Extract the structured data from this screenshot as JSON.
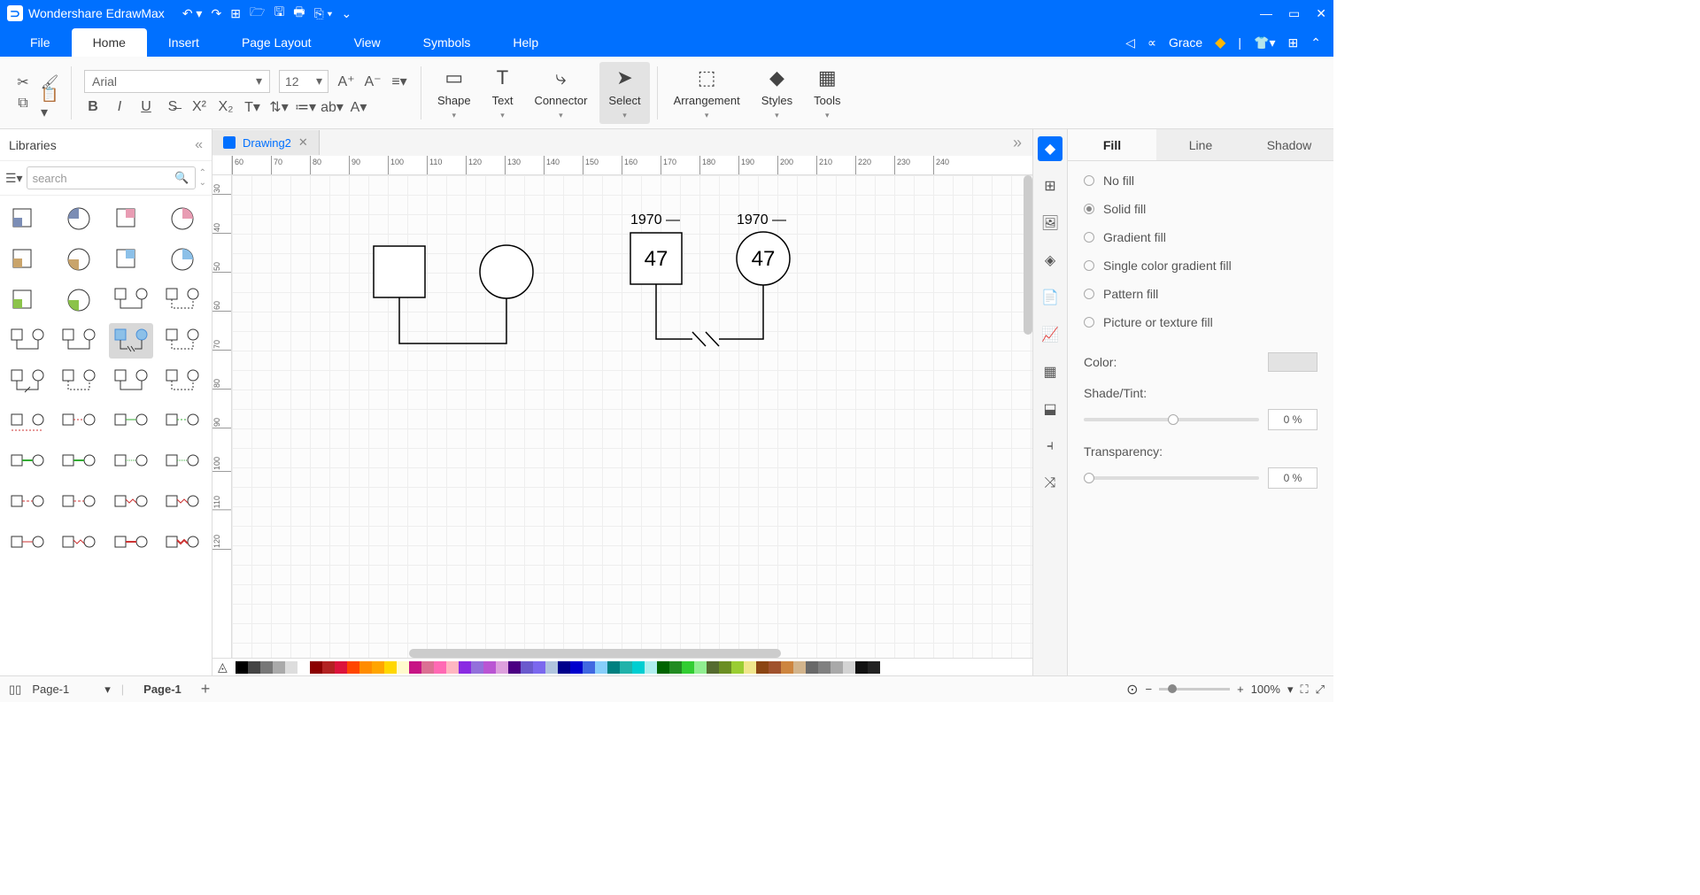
{
  "app": {
    "name": "Wondershare EdrawMax"
  },
  "user": {
    "name": "Grace"
  },
  "menu": {
    "items": [
      "File",
      "Home",
      "Insert",
      "Page Layout",
      "View",
      "Symbols",
      "Help"
    ],
    "active": "Home"
  },
  "ribbon": {
    "font": "Arial",
    "size": "12",
    "tools": {
      "shape": "Shape",
      "text": "Text",
      "connector": "Connector",
      "select": "Select",
      "arrangement": "Arrangement",
      "styles": "Styles",
      "tools": "Tools"
    },
    "selected_tool": "select"
  },
  "libraries": {
    "title": "Libraries",
    "search_placeholder": "search"
  },
  "document": {
    "tab_name": "Drawing2"
  },
  "ruler": {
    "h": [
      "60",
      "70",
      "80",
      "90",
      "100",
      "110",
      "120",
      "130",
      "140",
      "150",
      "160",
      "170",
      "180",
      "190",
      "200",
      "210",
      "220",
      "230",
      "240"
    ],
    "v": [
      "30",
      "40",
      "50",
      "60",
      "70",
      "80",
      "90",
      "100",
      "110",
      "120"
    ]
  },
  "canvas": {
    "shape_left": {
      "year": "1970 —",
      "age": "47"
    },
    "shape_right": {
      "year": "1970 —",
      "age": "47"
    }
  },
  "props": {
    "tabs": [
      "Fill",
      "Line",
      "Shadow"
    ],
    "active_tab": "Fill",
    "options": [
      "No fill",
      "Solid fill",
      "Gradient fill",
      "Single color gradient fill",
      "Pattern fill",
      "Picture or texture fill"
    ],
    "selected_option": "Solid fill",
    "color_label": "Color:",
    "shade_label": "Shade/Tint:",
    "shade_value": "0 %",
    "transparency_label": "Transparency:",
    "transparency_value": "0 %"
  },
  "colorbar": [
    "#000",
    "#444",
    "#777",
    "#aaa",
    "#ddd",
    "#fff",
    "#8b0000",
    "#b22222",
    "#dc143c",
    "#ff4500",
    "#ff8c00",
    "#ffa500",
    "#ffd700",
    "#fffacd",
    "#c71585",
    "#db7093",
    "#ff69b4",
    "#ffb6c1",
    "#8a2be2",
    "#9370db",
    "#ba55d3",
    "#dda0dd",
    "#4b0082",
    "#6a5acd",
    "#7b68ee",
    "#b0c4de",
    "#00008b",
    "#0000cd",
    "#4169e1",
    "#87cefa",
    "#008080",
    "#20b2aa",
    "#00ced1",
    "#afeeee",
    "#006400",
    "#228b22",
    "#32cd32",
    "#90ee90",
    "#556b2f",
    "#6b8e23",
    "#9acd32",
    "#f0e68c",
    "#8b4513",
    "#a0522d",
    "#cd853f",
    "#d2b48c",
    "#696969",
    "#808080",
    "#a9a9a9",
    "#d3d3d3",
    "#111",
    "#222"
  ],
  "status": {
    "page_dropdown": "Page-1",
    "page_tab": "Page-1",
    "zoom": "100%"
  }
}
